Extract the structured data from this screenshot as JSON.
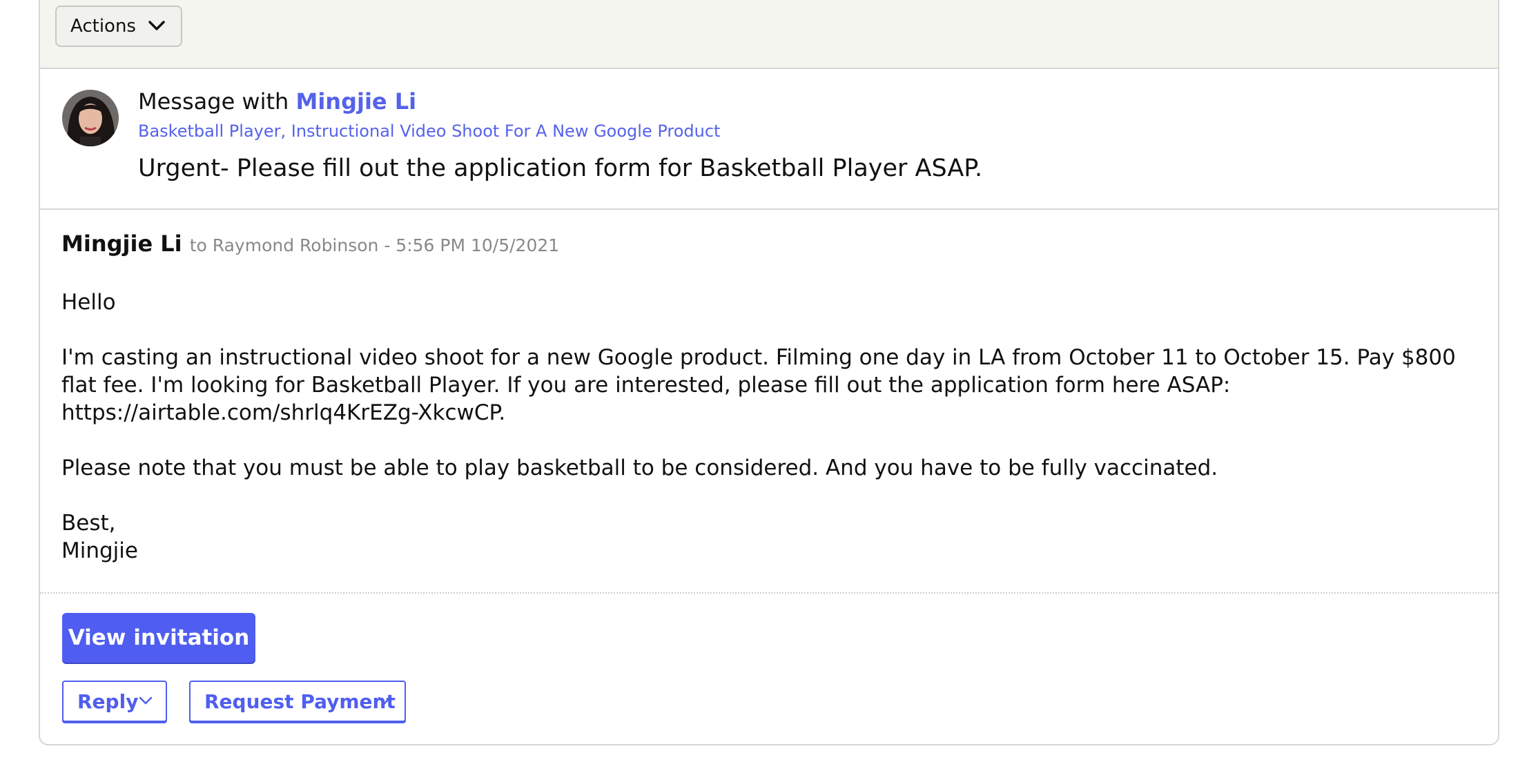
{
  "toolbar": {
    "actions_label": "Actions"
  },
  "header": {
    "title_prefix": "Message with",
    "contact_name": "Mingjie Li",
    "project": "Basketball Player, Instructional Video Shoot For A New Google Product",
    "subject": "Urgent- Please fill out the application form for Basketball Player ASAP."
  },
  "message": {
    "sender": "Mingjie Li",
    "meta": "to Raymond Robinson - 5:56 PM 10/5/2021",
    "greeting": "Hello",
    "paragraph1": "I'm casting an instructional video shoot for a new Google product. Filming one day in LA from October 11 to October 15. Pay $800 flat fee. I'm looking for Basketball Player. If you are interested, please fill out the application form here ASAP: https://airtable.com/shrlq4KrEZg-XkcwCP.",
    "paragraph2": "Please note that you must be able to play basketball to be considered. And you have to be fully vaccinated.",
    "signoff": "Best,",
    "signature": "Mingjie"
  },
  "actions": {
    "view_invitation": "View invitation",
    "reply": "Reply",
    "request_payment": "Request Payment"
  },
  "colors": {
    "accent": "#4f5ef0",
    "link": "#5562ea",
    "toolbar_bg": "#f5f5f0",
    "meta_gray": "#888888"
  },
  "icons": {
    "actions_dropdown": "chevron-down-icon",
    "reply_dropdown": "chevron-down-icon",
    "payment_dropdown": "chevron-down-icon"
  }
}
